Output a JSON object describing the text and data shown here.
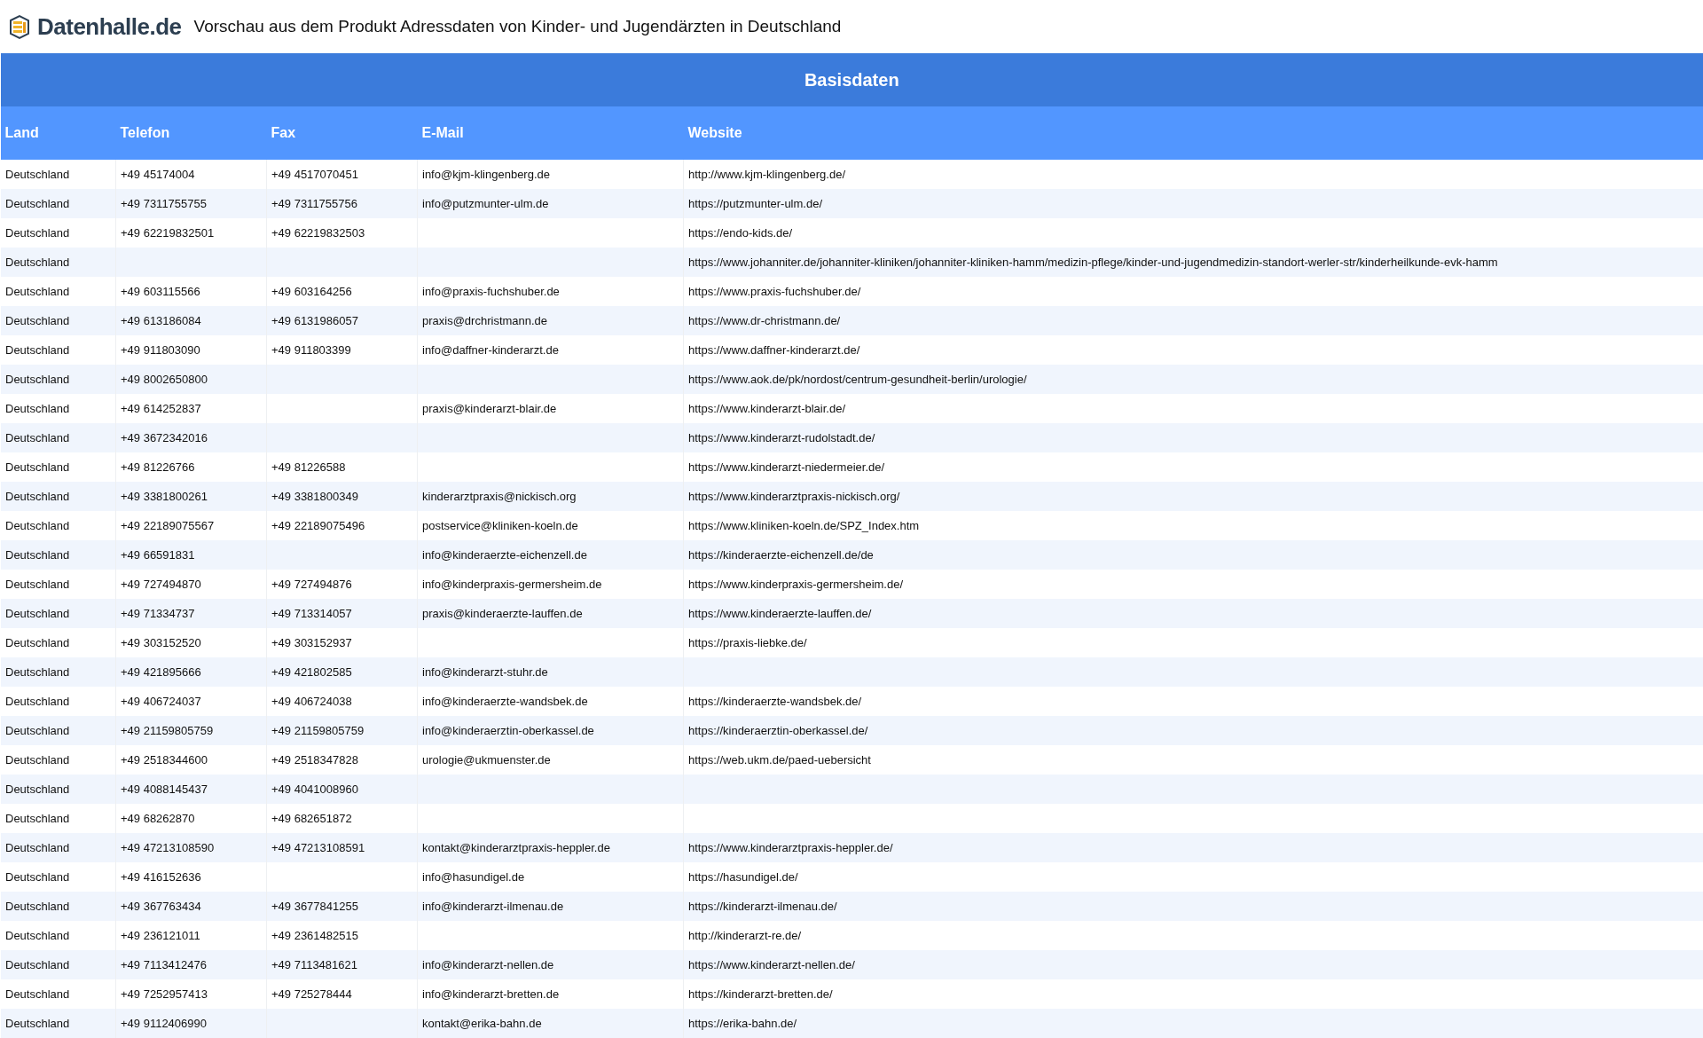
{
  "header": {
    "logo": "Datenhalle.de",
    "title": "Vorschau aus dem Produkt Adressdaten von Kinder- und Jugendärzten in Deutschland"
  },
  "table": {
    "group": "Basisdaten",
    "columns": [
      "Land",
      "Telefon",
      "Fax",
      "E-Mail",
      "Website"
    ],
    "rows": [
      [
        "Deutschland",
        "+49 45174004",
        "+49 4517070451",
        "info@kjm-klingenberg.de",
        "http://www.kjm-klingenberg.de/"
      ],
      [
        "Deutschland",
        "+49 7311755755",
        "+49 7311755756",
        "info@putzmunter-ulm.de",
        "https://putzmunter-ulm.de/"
      ],
      [
        "Deutschland",
        "+49 62219832501",
        "+49 62219832503",
        "",
        "https://endo-kids.de/"
      ],
      [
        "Deutschland",
        "",
        "",
        "",
        "https://www.johanniter.de/johanniter-kliniken/johanniter-kliniken-hamm/medizin-pflege/kinder-und-jugendmedizin-standort-werler-str/kinderheilkunde-evk-hamm"
      ],
      [
        "Deutschland",
        "+49 603115566",
        "+49 603164256",
        "info@praxis-fuchshuber.de",
        "https://www.praxis-fuchshuber.de/"
      ],
      [
        "Deutschland",
        "+49 613186084",
        "+49 6131986057",
        "praxis@drchristmann.de",
        "https://www.dr-christmann.de/"
      ],
      [
        "Deutschland",
        "+49 911803090",
        "+49 911803399",
        "info@daffner-kinderarzt.de",
        "https://www.daffner-kinderarzt.de/"
      ],
      [
        "Deutschland",
        "+49 8002650800",
        "",
        "",
        "https://www.aok.de/pk/nordost/centrum-gesundheit-berlin/urologie/"
      ],
      [
        "Deutschland",
        "+49 614252837",
        "",
        "praxis@kinderarzt-blair.de",
        "https://www.kinderarzt-blair.de/"
      ],
      [
        "Deutschland",
        "+49 3672342016",
        "",
        "",
        "https://www.kinderarzt-rudolstadt.de/"
      ],
      [
        "Deutschland",
        "+49 81226766",
        "+49 81226588",
        "",
        "https://www.kinderarzt-niedermeier.de/"
      ],
      [
        "Deutschland",
        "+49 3381800261",
        "+49 3381800349",
        "kinderarztpraxis@nickisch.org",
        "https://www.kinderarztpraxis-nickisch.org/"
      ],
      [
        "Deutschland",
        "+49 22189075567",
        "+49 22189075496",
        "postservice@kliniken-koeln.de",
        "https://www.kliniken-koeln.de/SPZ_Index.htm"
      ],
      [
        "Deutschland",
        "+49 66591831",
        "",
        "info@kinderaerzte-eichenzell.de",
        "https://kinderaerzte-eichenzell.de/de"
      ],
      [
        "Deutschland",
        "+49 727494870",
        "+49 727494876",
        "info@kinderpraxis-germersheim.de",
        "https://www.kinderpraxis-germersheim.de/"
      ],
      [
        "Deutschland",
        "+49 71334737",
        "+49 713314057",
        "praxis@kinderaerzte-lauffen.de",
        "https://www.kinderaerzte-lauffen.de/"
      ],
      [
        "Deutschland",
        "+49 303152520",
        "+49 303152937",
        "",
        "https://praxis-liebke.de/"
      ],
      [
        "Deutschland",
        "+49 421895666",
        "+49 421802585",
        "info@kinderarzt-stuhr.de",
        ""
      ],
      [
        "Deutschland",
        "+49 406724037",
        "+49 406724038",
        "info@kinderaerzte-wandsbek.de",
        "https://kinderaerzte-wandsbek.de/"
      ],
      [
        "Deutschland",
        "+49 21159805759",
        "+49 21159805759",
        "info@kinderaerztin-oberkassel.de",
        "https://kinderaerztin-oberkassel.de/"
      ],
      [
        "Deutschland",
        "+49 2518344600",
        "+49 2518347828",
        "urologie@ukmuenster.de",
        "https://web.ukm.de/paed-uebersicht"
      ],
      [
        "Deutschland",
        "+49 4088145437",
        "+49 4041008960",
        "",
        ""
      ],
      [
        "Deutschland",
        "+49 68262870",
        "+49 682651872",
        "",
        ""
      ],
      [
        "Deutschland",
        "+49 47213108590",
        "+49 47213108591",
        "kontakt@kinderarztpraxis-heppler.de",
        "https://www.kinderarztpraxis-heppler.de/"
      ],
      [
        "Deutschland",
        "+49 416152636",
        "",
        "info@hasundigel.de",
        "https://hasundigel.de/"
      ],
      [
        "Deutschland",
        "+49 367763434",
        "+49 3677841255",
        "info@kinderarzt-ilmenau.de",
        "https://kinderarzt-ilmenau.de/"
      ],
      [
        "Deutschland",
        "+49 236121011",
        "+49 2361482515",
        "",
        "http://kinderarzt-re.de/"
      ],
      [
        "Deutschland",
        "+49 7113412476",
        "+49 7113481621",
        "info@kinderarzt-nellen.de",
        "https://www.kinderarzt-nellen.de/"
      ],
      [
        "Deutschland",
        "+49 7252957413",
        "+49 725278444",
        "info@kinderarzt-bretten.de",
        "https://kinderarzt-bretten.de/"
      ],
      [
        "Deutschland",
        "+49 9112406990",
        "",
        "kontakt@erika-bahn.de",
        "https://erika-bahn.de/"
      ]
    ]
  }
}
